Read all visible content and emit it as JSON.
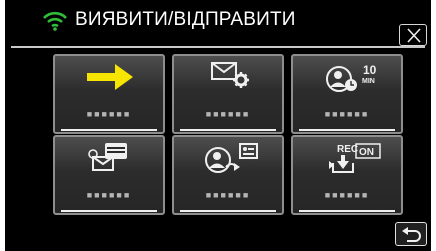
{
  "header": {
    "title": "ВИЯВИТИ/ВІДПРАВИТИ",
    "wifi_icon": "wifi-icon",
    "close_icon": "close-icon",
    "accent_color": "#2fbf3a"
  },
  "menu": {
    "items": [
      {
        "name": "arrow-right",
        "icon": "arrow-right-icon",
        "label": "■■■■■■"
      },
      {
        "name": "mail-settings",
        "icon": "mail-gear-icon",
        "label": "■■■■■■"
      },
      {
        "name": "monitor-10-min",
        "icon": "person-clock-10min-icon",
        "badge": "10",
        "badge_sub": "MIN",
        "label": "■■■■■■"
      },
      {
        "name": "mail-camera",
        "icon": "mail-camera-icon",
        "label": "■■■■■■"
      },
      {
        "name": "send-picture",
        "icon": "person-picture-icon",
        "label": "■■■■■■"
      },
      {
        "name": "rec-on",
        "icon": "rec-download-icon",
        "badge": "REC",
        "status": "ON",
        "label": "■■■■■■"
      }
    ]
  },
  "footer": {
    "back_icon": "back-icon"
  }
}
